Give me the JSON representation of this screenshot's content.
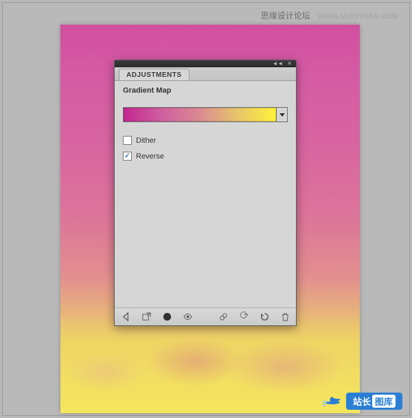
{
  "watermark": {
    "text": "思缘设计论坛",
    "url": "WWW.MISSYUAN.COM"
  },
  "panel": {
    "tab": "ADJUSTMENTS",
    "title": "Gradient Map",
    "gradient_stops": [
      "#c3278f",
      "#d15fa0",
      "#da8a92",
      "#e7c66a",
      "#fff23a"
    ],
    "dither": {
      "label": "Dither",
      "checked": false
    },
    "reverse": {
      "label": "Reverse",
      "checked": true
    }
  },
  "footer_icons": {
    "back": "back-arrow-icon",
    "expand": "expand-icon",
    "new_mask": "circle-mask-icon",
    "visibility": "eye-icon",
    "clip": "clip-icon",
    "prev_state": "reset-icon",
    "reset": "reset-circle-icon",
    "trash": "trash-icon"
  },
  "badge": {
    "text1": "站长",
    "text2": "图库"
  }
}
